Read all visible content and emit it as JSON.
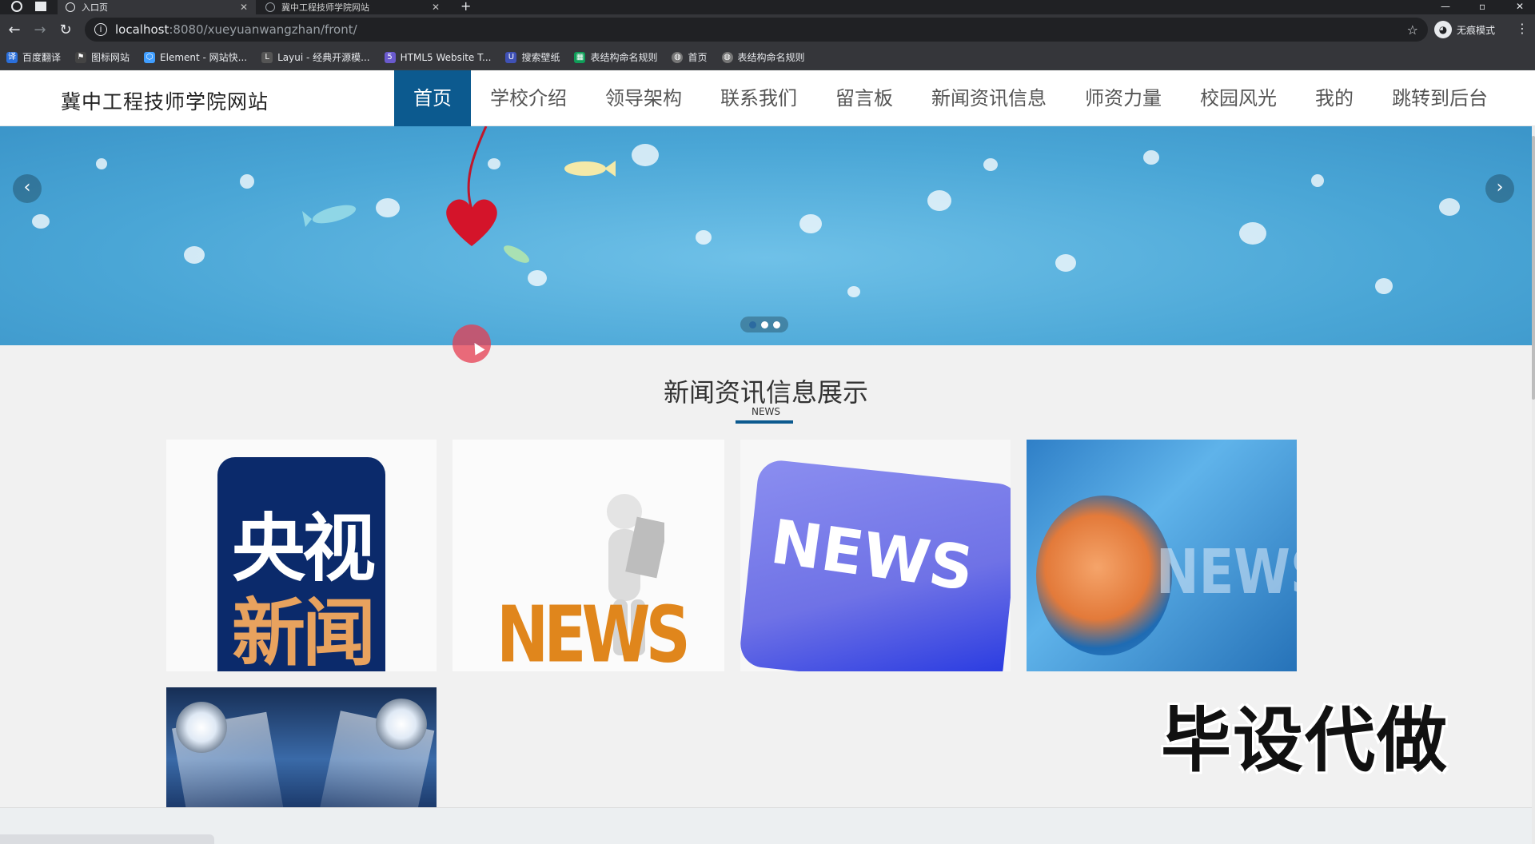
{
  "browser": {
    "tabs": [
      {
        "label": "入口页",
        "active": true
      },
      {
        "label": "冀中工程技师学院网站",
        "active": false
      }
    ],
    "url_host": "localhost",
    "url_path": ":8080/xueyuanwangzhan/front/",
    "incognito_label": "无痕模式",
    "bookmarks": [
      {
        "label": "百度翻译",
        "icon": "translate-icon",
        "color": "#2a6fdb"
      },
      {
        "label": "图标网站",
        "icon": "flag-icon",
        "color": "#444444"
      },
      {
        "label": "Element - 网站快...",
        "icon": "element-icon",
        "color": "#409eff"
      },
      {
        "label": "Layui - 经典开源模...",
        "icon": "layui-icon",
        "color": "#555555"
      },
      {
        "label": "HTML5 Website T...",
        "icon": "html5-icon",
        "color": "#6a5acd"
      },
      {
        "label": "搜索壁纸",
        "icon": "wallpaper-icon",
        "color": "#3f51b5"
      },
      {
        "label": "表结构命名规则",
        "icon": "sheet-icon",
        "color": "#0f9d58"
      },
      {
        "label": "首页",
        "icon": "globe-icon",
        "color": "#777777"
      },
      {
        "label": "表结构命名规则",
        "icon": "globe-icon",
        "color": "#777777"
      }
    ]
  },
  "site": {
    "logo": "冀中工程技师学院网站",
    "nav": [
      {
        "label": "首页",
        "active": true
      },
      {
        "label": "学校介绍",
        "active": false
      },
      {
        "label": "领导架构",
        "active": false
      },
      {
        "label": "联系我们",
        "active": false
      },
      {
        "label": "留言板",
        "active": false
      },
      {
        "label": "新闻资讯信息",
        "active": false
      },
      {
        "label": "师资力量",
        "active": false
      },
      {
        "label": "校园风光",
        "active": false
      },
      {
        "label": "我的",
        "active": false
      },
      {
        "label": "跳转到后台",
        "active": false
      }
    ],
    "accent_color": "#0c5a8f"
  },
  "carousel": {
    "slides": 3,
    "active_index": 0
  },
  "news_section": {
    "title": "新闻资讯信息展示",
    "subtitle": "NEWS",
    "cards": [
      {
        "image_text_top": "央视",
        "image_text_bottom": "新闻"
      },
      {
        "image_text": "NEWS"
      },
      {
        "image_text": "NEWS"
      },
      {
        "image_text": "NEWS"
      },
      {
        "image_text": ""
      }
    ]
  },
  "watermark": "毕设代做"
}
